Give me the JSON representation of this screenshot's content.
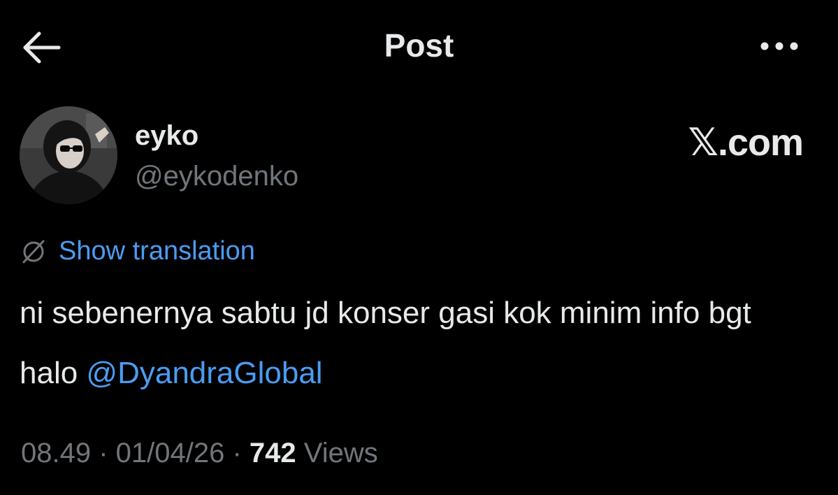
{
  "header": {
    "title": "Post",
    "back_icon": "arrow-left-icon",
    "more_icon": "more-horizontal-icon"
  },
  "author": {
    "display_name": "eyko",
    "handle": "@eykodenko"
  },
  "brand": {
    "label": "𝕏.com"
  },
  "translation": {
    "icon": "globe-slash-icon",
    "label": "Show translation"
  },
  "post": {
    "text_before": "ni sebenernya sabtu jd konser gasi kok minim info bgt halo ",
    "mention": "@DyandraGlobal"
  },
  "meta": {
    "time": "08.49",
    "separator": " · ",
    "date": "01/04/26",
    "views_count": "742",
    "views_label": "Views"
  },
  "colors": {
    "background": "#000000",
    "text_primary": "#e7e9ea",
    "text_secondary": "#71767b",
    "link": "#4b9cf3"
  }
}
